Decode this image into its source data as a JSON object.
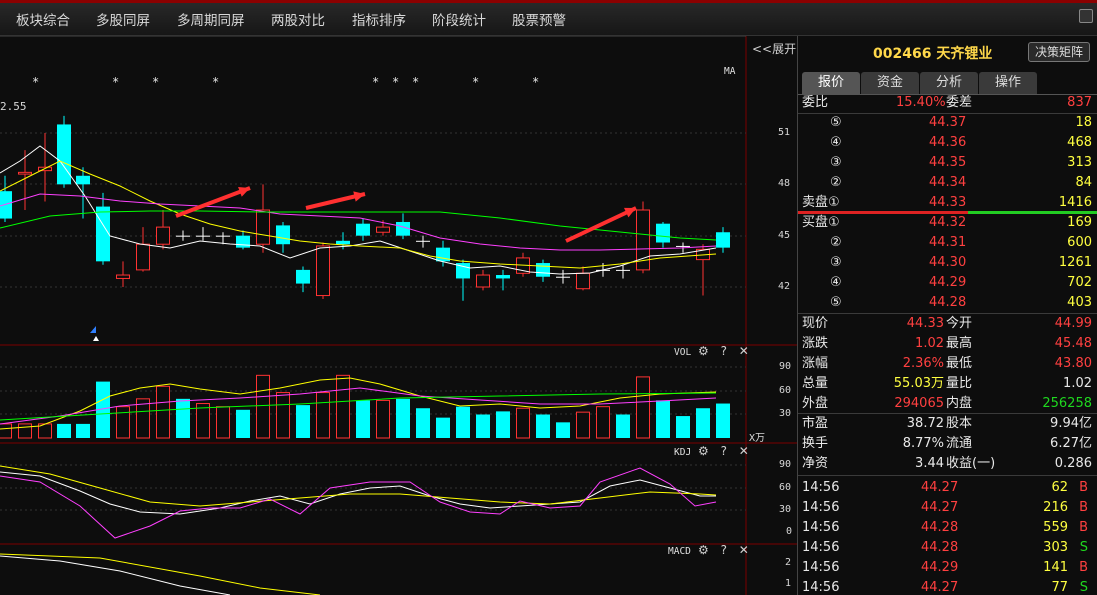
{
  "menu": [
    "板块综合",
    "多股同屏",
    "多周期同屏",
    "两股对比",
    "指标排序",
    "阶段统计",
    "股票预警"
  ],
  "chart": {
    "expand_label": "<<展开",
    "ma_label": "MA",
    "price_partial_label": "2.55",
    "price_axis": [
      "51",
      "48",
      "45",
      "42"
    ],
    "vol_label": "VOL",
    "vol_axis": [
      "90",
      "60",
      "30"
    ],
    "vol_unit": "X万",
    "kdj_label": "KDJ",
    "kdj_axis": [
      "90",
      "60",
      "30",
      "0"
    ],
    "macd_label": "MACD",
    "macd_axis": [
      "2",
      "1"
    ],
    "panel_icons": "⚙ ? ✕",
    "star_glyph": "*",
    "colors": {
      "up": "#ff3232",
      "down": "#00ffff",
      "ma1": "#ffffff",
      "ma2": "#ffff00",
      "ma3": "#ff40ff",
      "ma4": "#00ff00",
      "arrow": "#ff3030"
    }
  },
  "stock": {
    "code": "002466",
    "name": "天齐锂业",
    "decision_button": "决策矩阵"
  },
  "tabs": [
    "报价",
    "资金",
    "分析",
    "操作"
  ],
  "order_book": {
    "ratio_label": "委比",
    "ratio_value": "15.40%",
    "diff_label": "委差",
    "diff_value": "837",
    "asks": [
      {
        "label": "⑤",
        "price": "44.37",
        "vol": "18"
      },
      {
        "label": "④",
        "price": "44.36",
        "vol": "468"
      },
      {
        "label": "③",
        "price": "44.35",
        "vol": "313"
      },
      {
        "label": "②",
        "price": "44.34",
        "vol": "84"
      },
      {
        "label": "卖盘①",
        "price": "44.33",
        "vol": "1416"
      }
    ],
    "bids": [
      {
        "label": "买盘①",
        "price": "44.32",
        "vol": "169"
      },
      {
        "label": "②",
        "price": "44.31",
        "vol": "600"
      },
      {
        "label": "③",
        "price": "44.30",
        "vol": "1261"
      },
      {
        "label": "④",
        "price": "44.29",
        "vol": "702"
      },
      {
        "label": "⑤",
        "price": "44.28",
        "vol": "403"
      }
    ]
  },
  "stats": [
    {
      "l1": "现价",
      "v1": "44.33",
      "c1": "red",
      "l2": "今开",
      "v2": "44.99",
      "c2": "red"
    },
    {
      "l1": "涨跌",
      "v1": "1.02",
      "c1": "red",
      "l2": "最高",
      "v2": "45.48",
      "c2": "red"
    },
    {
      "l1": "涨幅",
      "v1": "2.36%",
      "c1": "red",
      "l2": "最低",
      "v2": "43.80",
      "c2": "red"
    },
    {
      "l1": "总量",
      "v1": "55.03万",
      "c1": "yellow",
      "l2": "量比",
      "v2": "1.02",
      "c2": "white"
    },
    {
      "l1": "外盘",
      "v1": "294065",
      "c1": "red",
      "l2": "内盘",
      "v2": "256258",
      "c2": "green"
    },
    {
      "l1": "市盈",
      "v1": "38.72",
      "c1": "white",
      "l2": "股本",
      "v2": "9.94亿",
      "c2": "white"
    },
    {
      "l1": "换手",
      "v1": "8.77%",
      "c1": "white",
      "l2": "流通",
      "v2": "6.27亿",
      "c2": "white"
    },
    {
      "l1": "净资",
      "v1": "3.44",
      "c1": "white",
      "l2": "收益(一)",
      "v2": "0.286",
      "c2": "white"
    }
  ],
  "ticks": [
    {
      "time": "14:56",
      "price": "44.27",
      "vol": "62",
      "side": "B"
    },
    {
      "time": "14:56",
      "price": "44.27",
      "vol": "216",
      "side": "B"
    },
    {
      "time": "14:56",
      "price": "44.28",
      "vol": "559",
      "side": "B"
    },
    {
      "time": "14:56",
      "price": "44.28",
      "vol": "303",
      "side": "S"
    },
    {
      "time": "14:56",
      "price": "44.29",
      "vol": "141",
      "side": "B"
    },
    {
      "time": "14:56",
      "price": "44.27",
      "vol": "77",
      "side": "S"
    }
  ]
}
